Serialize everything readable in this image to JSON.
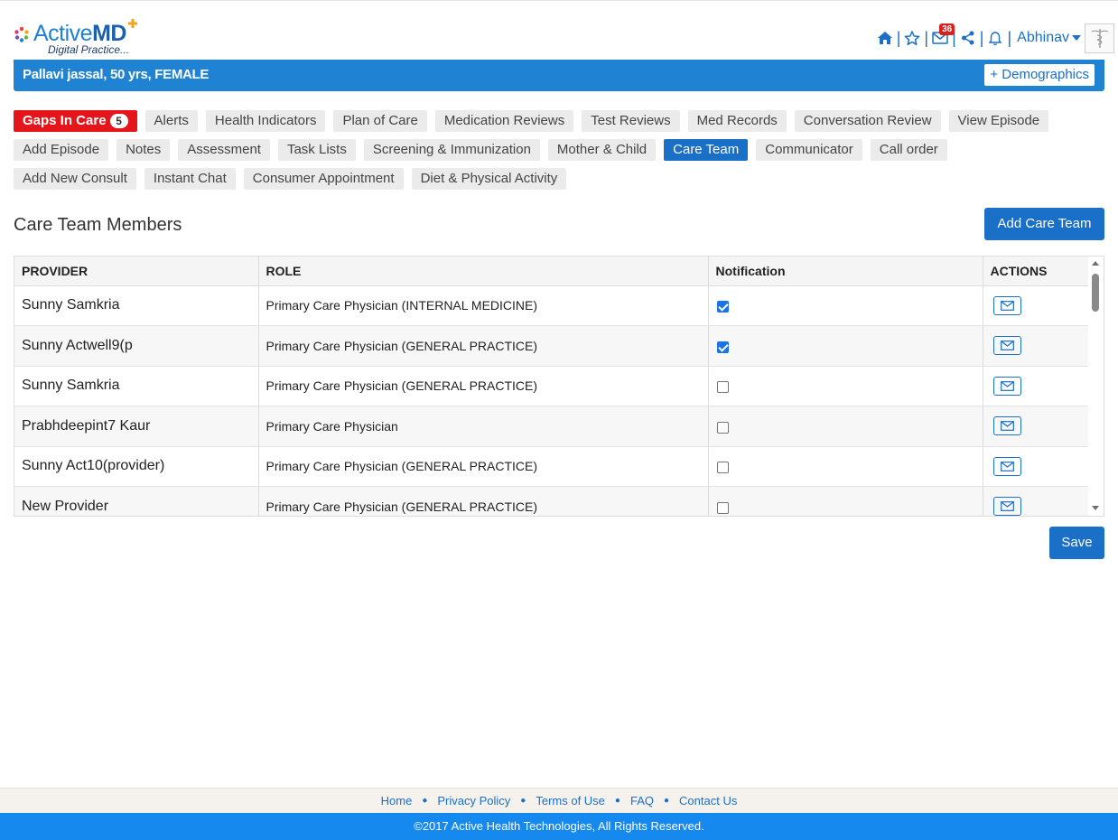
{
  "brand": {
    "name_light": "Active",
    "name_bold": "MD",
    "tagline": "Digital Practice..."
  },
  "header": {
    "message_count": "36",
    "user_name": "Abhinav",
    "icons": [
      "home-icon",
      "star-icon",
      "mail-icon",
      "share-icon",
      "bell-icon",
      "caduceus-icon"
    ]
  },
  "patient": {
    "summary": "Pallavi jassal, 50 yrs, FEMALE",
    "demographics_label": "+ Demographics"
  },
  "tabs": {
    "row1": [
      "Gaps In Care",
      "Alerts",
      "Health Indicators",
      "Plan of Care",
      "Medication Reviews",
      "Test Reviews",
      "Med Records",
      "Conversation Review",
      "View Episode"
    ],
    "row2": [
      "Add Episode",
      "Notes",
      "Assessment",
      "Task Lists",
      "Screening & Immunization",
      "Mother & Child",
      "Care Team",
      "Communicator",
      "Call order"
    ],
    "row3": [
      "Add New Consult",
      "Instant Chat",
      "Consumer Appointment",
      "Diet & Physical Activity"
    ],
    "gaps_count": "5",
    "active": "Care Team"
  },
  "care_team": {
    "title": "Care Team Members",
    "add_button": "Add Care Team",
    "columns": [
      "PROVIDER",
      "ROLE",
      "Notification",
      "ACTIONS"
    ],
    "rows": [
      {
        "provider": "Sunny Samkria",
        "role": "Primary Care Physician (INTERNAL MEDICINE)",
        "notify": true
      },
      {
        "provider": "Sunny Actwell9(p",
        "role": "Primary Care Physician (GENERAL PRACTICE)",
        "notify": true
      },
      {
        "provider": "Sunny Samkria",
        "role": "Primary Care Physician (GENERAL PRACTICE)",
        "notify": false
      },
      {
        "provider": "Prabhdeepint7 Kaur",
        "role": "Primary Care Physician",
        "notify": false
      },
      {
        "provider": "Sunny Act10(provider)",
        "role": "Primary Care Physician (GENERAL PRACTICE)",
        "notify": false
      },
      {
        "provider": "New Provider",
        "role": "Primary Care Physician (GENERAL PRACTICE)",
        "notify": false
      }
    ],
    "save_button": "Save"
  },
  "footer": {
    "links": [
      "Home",
      "Privacy Policy",
      "Terms of Use",
      "FAQ",
      "Contact Us"
    ],
    "copyright": "©2017 Active Health Technologies, All Rights Reserved."
  },
  "colors": {
    "primary": "#1a6fc7",
    "patient_bar": "#1f82d2",
    "gaps_tab": "#e5161b",
    "footer_bar": "#1589ee"
  }
}
